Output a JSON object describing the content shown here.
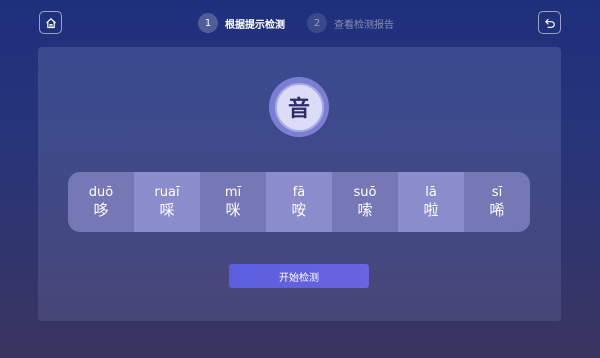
{
  "header": {
    "home_icon": "home-icon",
    "back_icon": "back-arrow-icon",
    "steps": [
      {
        "number": "1",
        "label": "根据提示检测",
        "active": true
      },
      {
        "number": "2",
        "label": "查看检测报告",
        "active": false
      }
    ]
  },
  "main": {
    "target_sound": "音",
    "syllables": [
      {
        "pinyin": "duō",
        "char": "哆"
      },
      {
        "pinyin": "ruaī",
        "char": "啋"
      },
      {
        "pinyin": "mī",
        "char": "咪"
      },
      {
        "pinyin": "fā",
        "char": "咹"
      },
      {
        "pinyin": "suō",
        "char": "嗦"
      },
      {
        "pinyin": "lā",
        "char": "啦"
      },
      {
        "pinyin": "sī",
        "char": "唏"
      }
    ],
    "start_button_label": "开始检测"
  },
  "colors": {
    "accent": "#5b5fdf",
    "badge": "#7b7fd4",
    "syllable_bg": "#7677b5",
    "syllable_alt_bg": "#8a8ccc"
  }
}
